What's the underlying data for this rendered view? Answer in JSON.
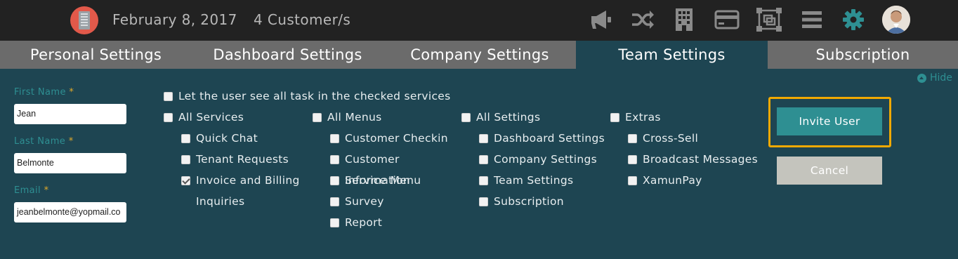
{
  "header": {
    "date": "February 8, 2017",
    "customers": "4 Customer/s",
    "icons": [
      "building-logo-icon",
      "megaphone-icon",
      "shuffle-icon",
      "building-icon",
      "credit-card-icon",
      "transform-icon",
      "menu-icon",
      "gear-icon",
      "avatar"
    ],
    "active_icon_color": "#2e8f92"
  },
  "tabs": [
    {
      "label": "Personal Settings"
    },
    {
      "label": "Dashboard Settings"
    },
    {
      "label": "Company Settings"
    },
    {
      "label": "Team Settings",
      "active": true
    },
    {
      "label": "Subscription"
    }
  ],
  "hide_label": "Hide",
  "form": {
    "first_name_label": "First Name",
    "first_name_value": "Jean",
    "last_name_label": "Last Name",
    "last_name_value": "Belmonte",
    "email_label": "Email",
    "email_value": "jeanbelmonte@yopmail.co",
    "required_mark": "*"
  },
  "permissions": {
    "see_all_tasks": {
      "label": "Let the user see all task in the checked services",
      "checked": false
    },
    "services": {
      "label": "All Services",
      "items": [
        {
          "label": "Quick Chat",
          "checked": false
        },
        {
          "label": "Tenant Requests",
          "checked": false
        },
        {
          "label": "Invoice and Billing",
          "label2": "Inquiries",
          "checked": true
        }
      ]
    },
    "menus": {
      "label": "All Menus",
      "items": [
        {
          "label": "Customer Checkin",
          "checked": false
        },
        {
          "label": "Customer",
          "label2a": "Information",
          "label2b": "Service Menu",
          "checked": false
        },
        {
          "label": "Survey",
          "checked": false
        },
        {
          "label": "Report",
          "checked": false
        }
      ]
    },
    "settings": {
      "label": "All Settings",
      "items": [
        {
          "label": "Dashboard Settings",
          "checked": false
        },
        {
          "label": "Company Settings",
          "checked": false
        },
        {
          "label": "Team Settings",
          "checked": false
        },
        {
          "label": "Subscription",
          "checked": false
        }
      ]
    },
    "extras": {
      "label": "Extras",
      "items": [
        {
          "label": "Cross-Sell",
          "checked": false
        },
        {
          "label": "Broadcast Messages",
          "checked": false
        },
        {
          "label": "XamunPay",
          "checked": false
        }
      ]
    }
  },
  "actions": {
    "invite_label": "Invite User",
    "cancel_label": "Cancel",
    "highlight_color": "#f2a900"
  }
}
